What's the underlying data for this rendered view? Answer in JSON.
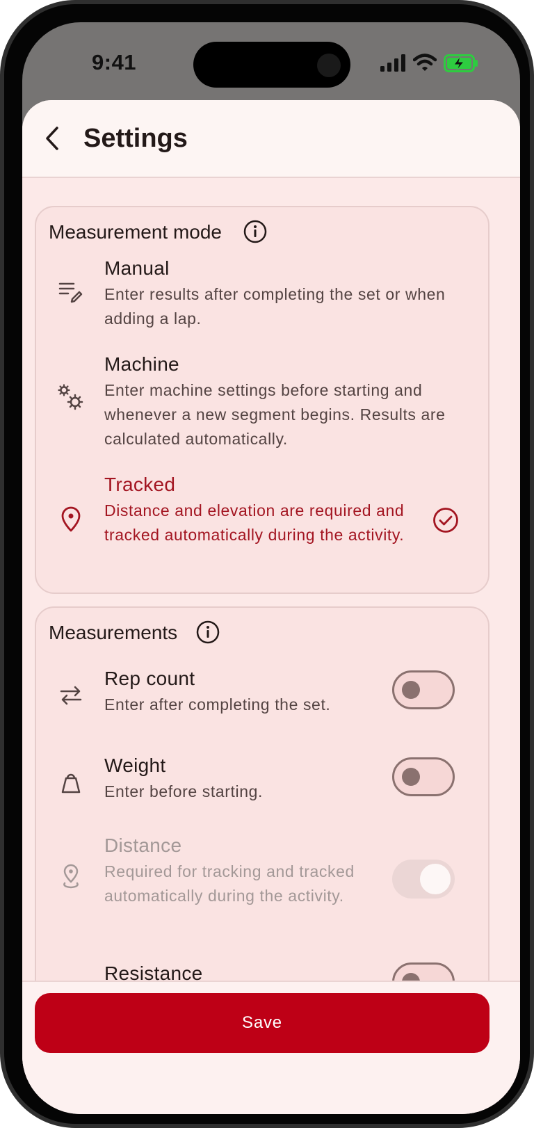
{
  "status_bar": {
    "time": "9:41"
  },
  "header": {
    "title": "Settings"
  },
  "measurement_mode": {
    "title": "Measurement mode",
    "options": [
      {
        "icon": "notes-edit-icon",
        "label": "Manual",
        "description": "Enter results after completing the set or when adding a lap."
      },
      {
        "icon": "gears-icon",
        "label": "Machine",
        "description": "Enter machine settings before starting and whenever a new segment begins. Results are calculated automatically."
      },
      {
        "icon": "location-pin-icon",
        "label": "Tracked",
        "description": "Distance and elevation are required and tracked automatically during the activity.",
        "selected": true
      }
    ]
  },
  "measurements": {
    "title": "Measurements",
    "items": [
      {
        "icon": "repeat-icon",
        "label": "Rep count",
        "description": "Enter after completing the set.",
        "enabled": false
      },
      {
        "icon": "weight-icon",
        "label": "Weight",
        "description": "Enter before starting.",
        "enabled": false
      },
      {
        "icon": "distance-pin-icon",
        "label": "Distance",
        "description": "Required for tracking and tracked automatically during the activity.",
        "enabled": true,
        "locked": true
      },
      {
        "icon": "resistance-icon",
        "label": "Resistance",
        "description": "",
        "enabled": false
      }
    ]
  },
  "footer": {
    "save_label": "Save"
  },
  "colors": {
    "accent": "#be0016",
    "selected_text": "#a31521",
    "card_bg": "#fae3e2"
  }
}
